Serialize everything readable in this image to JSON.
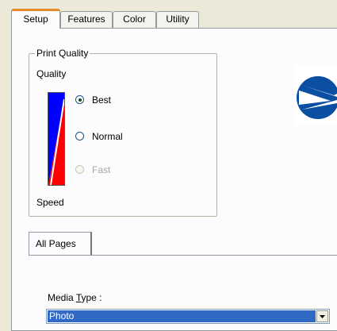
{
  "tabs": [
    {
      "label": "Setup",
      "active": true
    },
    {
      "label": "Features",
      "active": false
    },
    {
      "label": "Color",
      "active": false
    },
    {
      "label": "Utility",
      "active": false
    }
  ],
  "print_quality": {
    "group_label": "Print Quality",
    "quality_label": "Quality",
    "speed_label": "Speed",
    "options": [
      {
        "label": "Best",
        "selected": true,
        "enabled": true
      },
      {
        "label": "Normal",
        "selected": false,
        "enabled": true
      },
      {
        "label": "Fast",
        "selected": false,
        "enabled": false
      }
    ]
  },
  "pages_tab": {
    "label": "All Pages"
  },
  "media_type": {
    "label_prefix": "Media ",
    "label_accel": "T",
    "label_suffix": "ype :",
    "value": "Photo"
  },
  "colors": {
    "accent_tab": "#e68b2c",
    "selection": "#316ac5",
    "gauge_blue": "#0000ff",
    "gauge_red": "#ff0000"
  }
}
